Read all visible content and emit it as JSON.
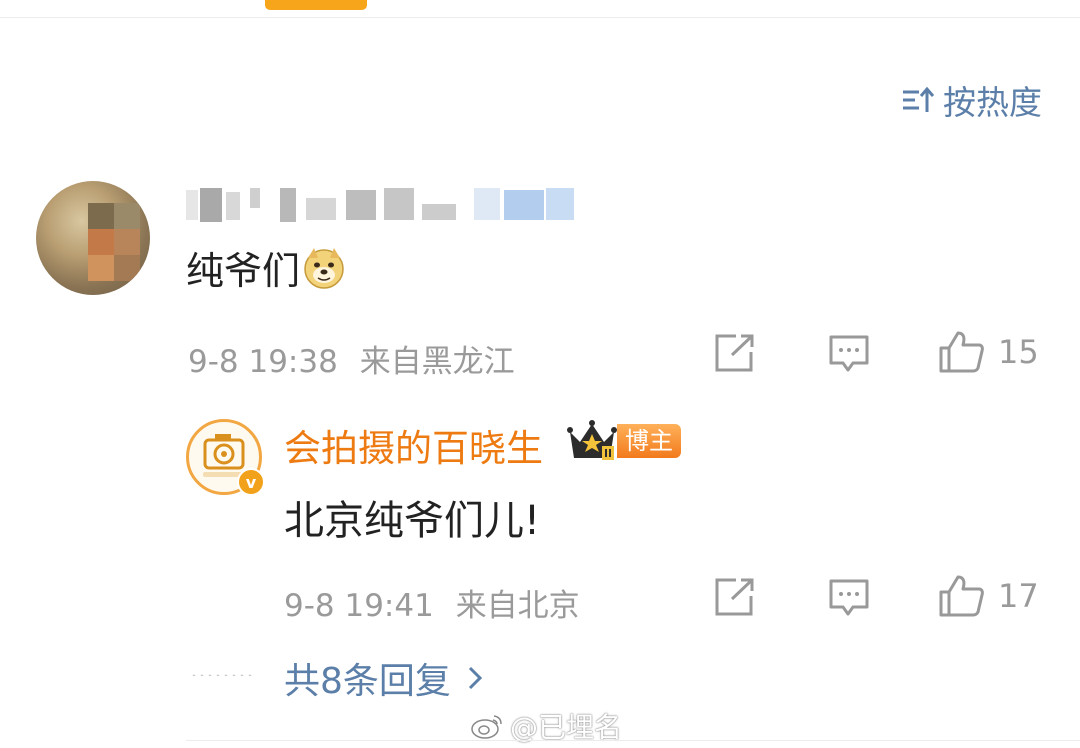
{
  "sort": {
    "label": "按热度",
    "icon": "sort-icon"
  },
  "comment": {
    "author": "",
    "text": "纯爷们",
    "emoji": "doge-emoji",
    "time": "9-8 19:38",
    "location": "来自黑龙江",
    "like_count": "15"
  },
  "reply": {
    "author": "会拍摄的百晓生",
    "badge": "博主",
    "avatar_text": "会拍摄的百晓生",
    "verified_mark": "v",
    "text": "北京纯爷们儿!",
    "time": "9-8 19:41",
    "location": "来自北京",
    "like_count": "17"
  },
  "more_replies": {
    "label": "共8条回复"
  },
  "watermark": {
    "text": "@已埋名"
  },
  "colors": {
    "accent": "#f7a51a",
    "link": "#5b7fa8",
    "reply_name": "#ee7a12",
    "meta": "#9a9a9a"
  }
}
